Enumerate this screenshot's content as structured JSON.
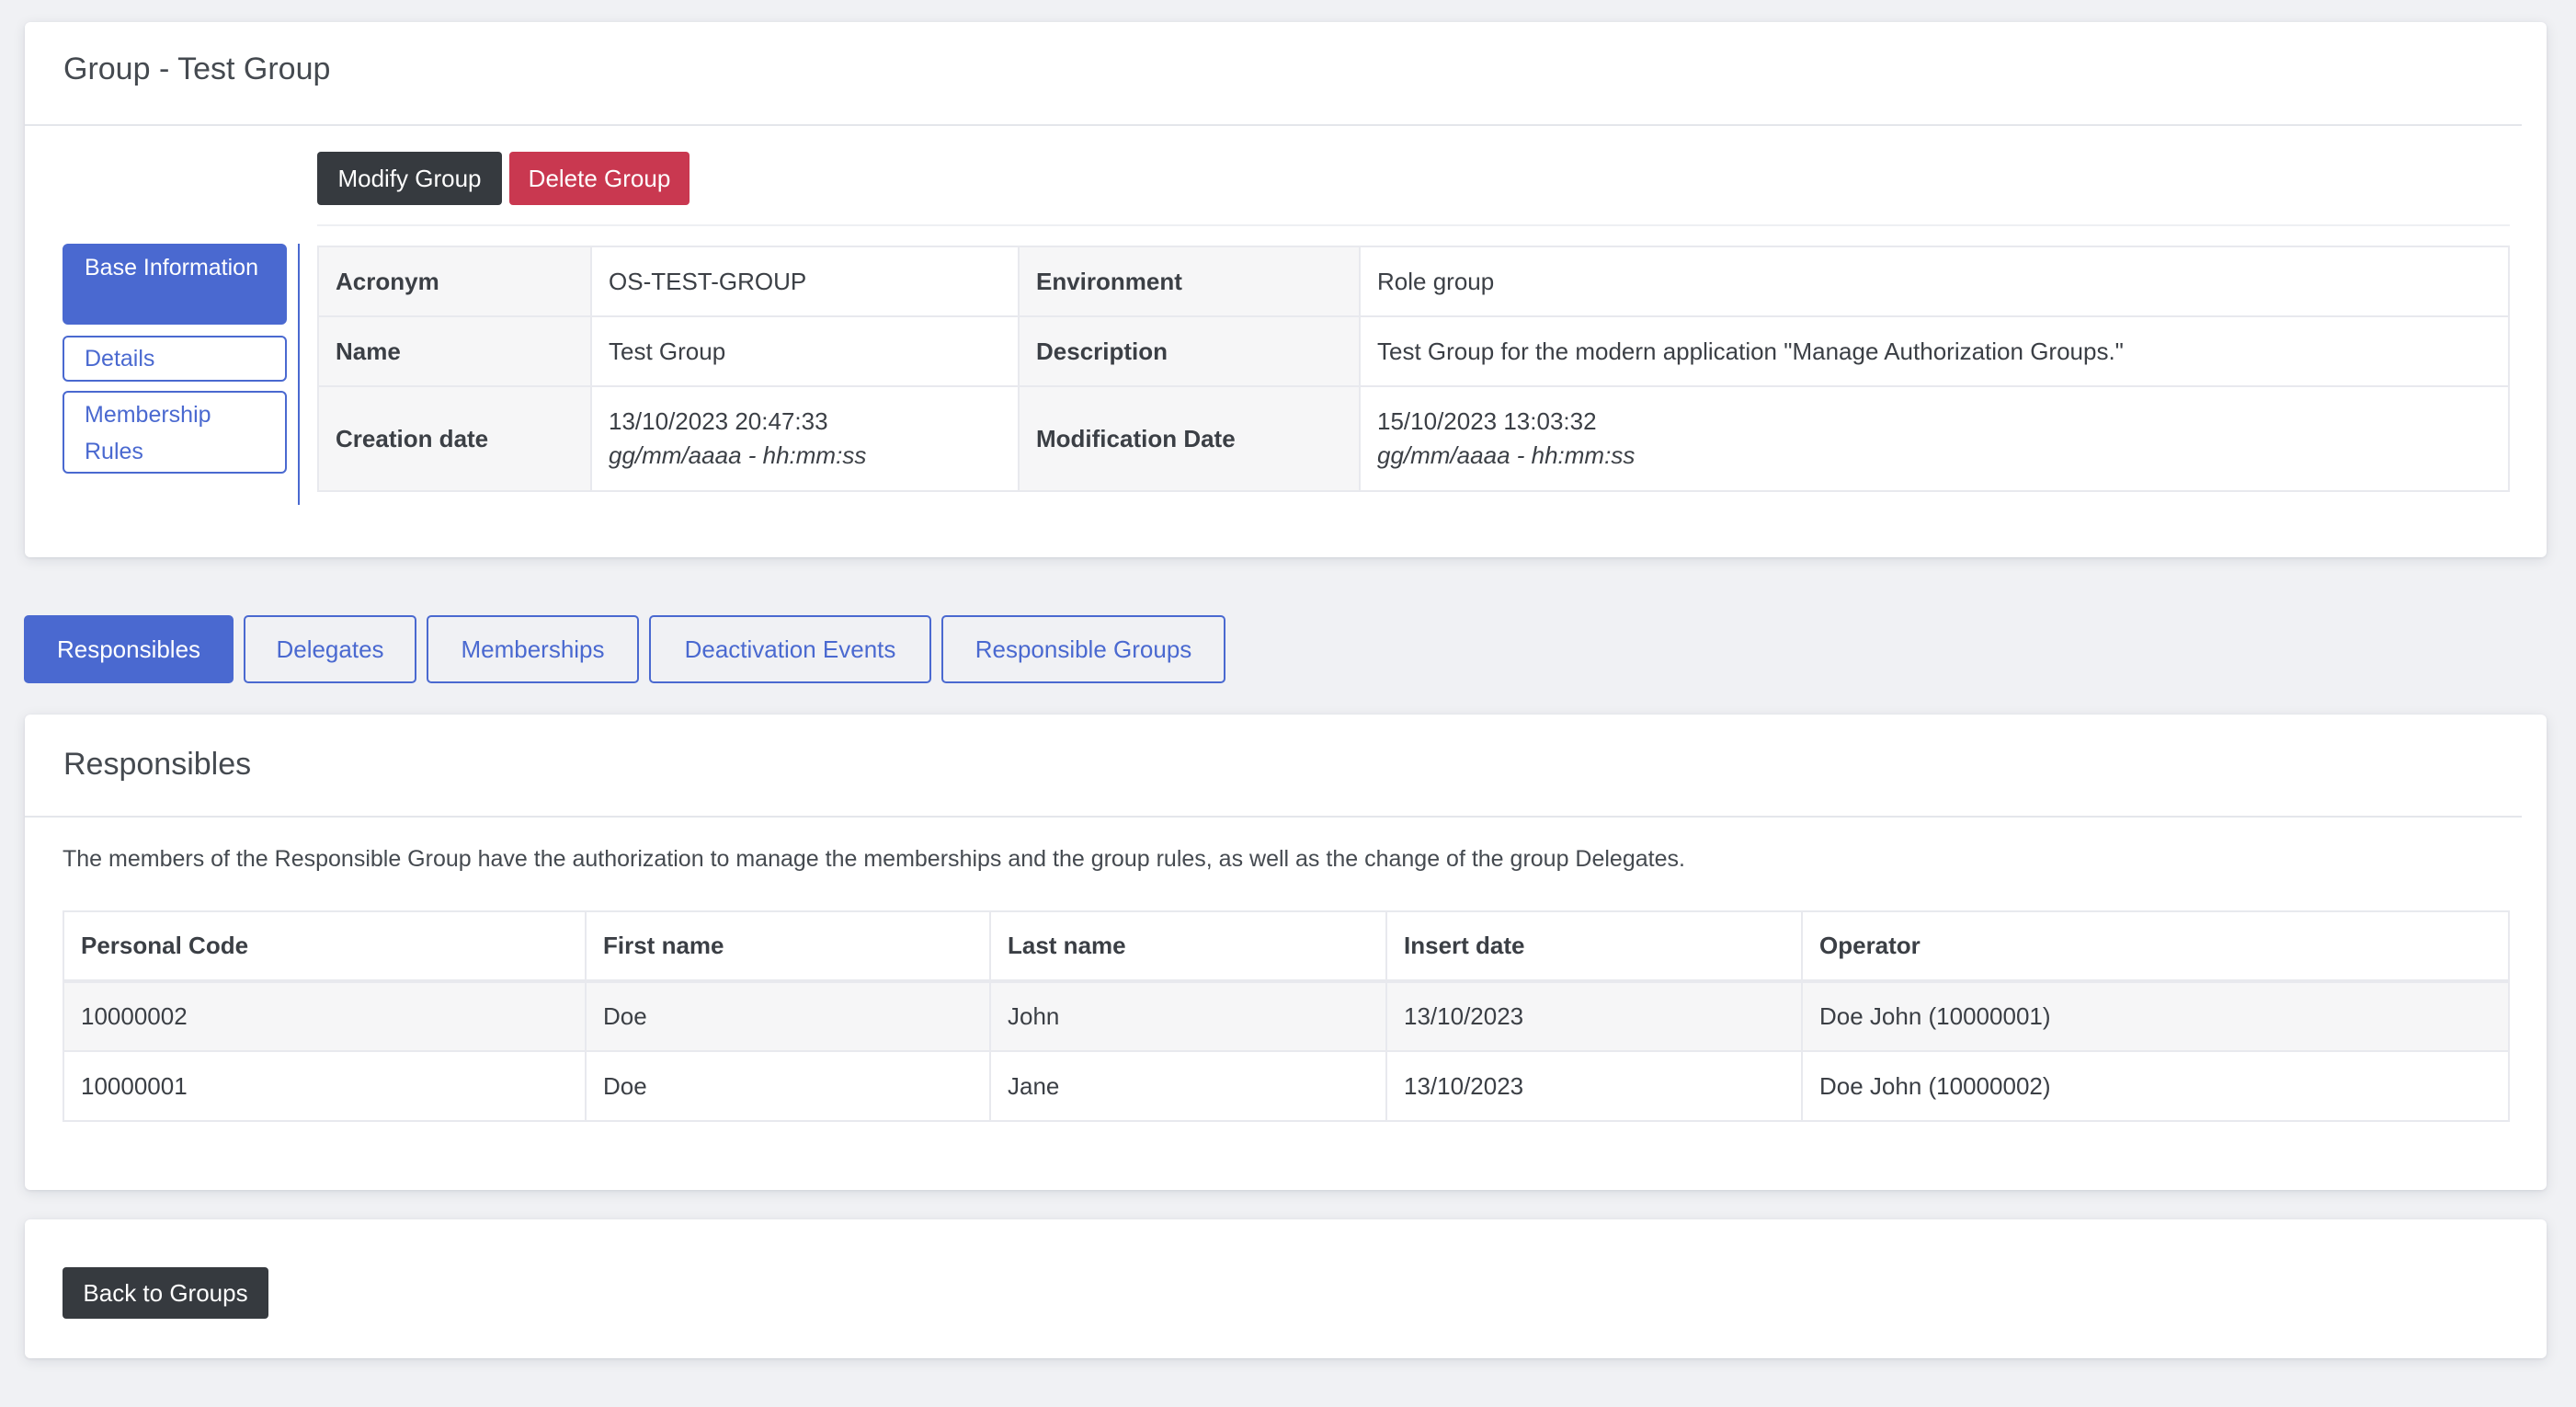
{
  "group_card": {
    "title": "Group - Test Group",
    "modify_button": "Modify Group",
    "delete_button": "Delete Group",
    "side_nav": [
      {
        "label": "Base Information",
        "active": true
      },
      {
        "label": "Details",
        "active": false
      },
      {
        "label": "Membership Rules",
        "active": false
      }
    ],
    "info": {
      "acronym_label": "Acronym",
      "acronym_value": "OS-TEST-GROUP",
      "environment_label": "Environment",
      "environment_value": "Role group",
      "name_label": "Name",
      "name_value": "Test Group",
      "description_label": "Description",
      "description_value": "Test Group for the modern application \"Manage Authorization Groups.\"",
      "creation_label": "Creation date",
      "creation_value": "13/10/2023 20:47:33",
      "creation_format": "gg/mm/aaaa - hh:mm:ss",
      "modification_label": "Modification Date",
      "modification_value": "15/10/2023 13:03:32",
      "modification_format": "gg/mm/aaaa - hh:mm:ss"
    }
  },
  "tabs": [
    {
      "label": "Responsibles",
      "active": true
    },
    {
      "label": "Delegates",
      "active": false
    },
    {
      "label": "Memberships",
      "active": false
    },
    {
      "label": "Deactivation Events",
      "active": false
    },
    {
      "label": "Responsible Groups",
      "active": false
    }
  ],
  "responsibles": {
    "title": "Responsibles",
    "description": "The members of the Responsible Group have the authorization to manage the memberships and the group rules, as well as the change of the group Delegates.",
    "columns": [
      "Personal Code",
      "First name",
      "Last name",
      "Insert date",
      "Operator"
    ],
    "rows": [
      [
        "10000002",
        "Doe",
        "John",
        "13/10/2023",
        "Doe John (10000001)"
      ],
      [
        "10000001",
        "Doe",
        "Jane",
        "13/10/2023",
        "Doe John (10000002)"
      ]
    ]
  },
  "footer": {
    "back_button": "Back to Groups"
  },
  "colors": {
    "primary": "#4a69d0",
    "dark": "#363a3f",
    "danger": "#c93850",
    "background": "#f0f1f4"
  }
}
